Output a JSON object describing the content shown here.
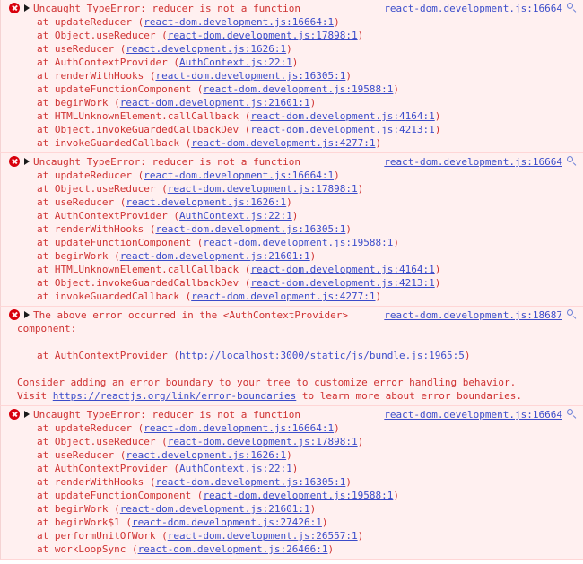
{
  "console": {
    "icons": {
      "error": "error-circle-icon",
      "disclosure": "disclosure-triangle-icon",
      "magnifier": "magnifier-icon"
    },
    "colors": {
      "background": "#fff0f0",
      "text": "#cf3232",
      "link": "#3b4cca",
      "error_icon": "#d8000c",
      "border": "#ffd6d6"
    },
    "groups": [
      {
        "title": "Uncaught TypeError: reducer is not a function",
        "source": "react-dom.development.js:16664",
        "lines": [
          {
            "type": "stack",
            "fn": "at updateReducer (",
            "loc": "react-dom.development.js:16664:1",
            "tail": ")"
          },
          {
            "type": "stack",
            "fn": "at Object.useReducer (",
            "loc": "react-dom.development.js:17898:1",
            "tail": ")"
          },
          {
            "type": "stack",
            "fn": "at useReducer (",
            "loc": "react.development.js:1626:1",
            "tail": ")"
          },
          {
            "type": "stack",
            "fn": "at AuthContextProvider (",
            "loc": "AuthContext.js:22:1",
            "tail": ")"
          },
          {
            "type": "stack",
            "fn": "at renderWithHooks (",
            "loc": "react-dom.development.js:16305:1",
            "tail": ")"
          },
          {
            "type": "stack",
            "fn": "at updateFunctionComponent (",
            "loc": "react-dom.development.js:19588:1",
            "tail": ")"
          },
          {
            "type": "stack",
            "fn": "at beginWork (",
            "loc": "react-dom.development.js:21601:1",
            "tail": ")"
          },
          {
            "type": "stack",
            "fn": "at HTMLUnknownElement.callCallback (",
            "loc": "react-dom.development.js:4164:1",
            "tail": ")"
          },
          {
            "type": "stack",
            "fn": "at Object.invokeGuardedCallbackDev (",
            "loc": "react-dom.development.js:4213:1",
            "tail": ")"
          },
          {
            "type": "stack",
            "fn": "at invokeGuardedCallback (",
            "loc": "react-dom.development.js:4277:1",
            "tail": ")"
          }
        ]
      },
      {
        "title": "Uncaught TypeError: reducer is not a function",
        "source": "react-dom.development.js:16664",
        "lines": [
          {
            "type": "stack",
            "fn": "at updateReducer (",
            "loc": "react-dom.development.js:16664:1",
            "tail": ")"
          },
          {
            "type": "stack",
            "fn": "at Object.useReducer (",
            "loc": "react-dom.development.js:17898:1",
            "tail": ")"
          },
          {
            "type": "stack",
            "fn": "at useReducer (",
            "loc": "react.development.js:1626:1",
            "tail": ")"
          },
          {
            "type": "stack",
            "fn": "at AuthContextProvider (",
            "loc": "AuthContext.js:22:1",
            "tail": ")"
          },
          {
            "type": "stack",
            "fn": "at renderWithHooks (",
            "loc": "react-dom.development.js:16305:1",
            "tail": ")"
          },
          {
            "type": "stack",
            "fn": "at updateFunctionComponent (",
            "loc": "react-dom.development.js:19588:1",
            "tail": ")"
          },
          {
            "type": "stack",
            "fn": "at beginWork (",
            "loc": "react-dom.development.js:21601:1",
            "tail": ")"
          },
          {
            "type": "stack",
            "fn": "at HTMLUnknownElement.callCallback (",
            "loc": "react-dom.development.js:4164:1",
            "tail": ")"
          },
          {
            "type": "stack",
            "fn": "at Object.invokeGuardedCallbackDev (",
            "loc": "react-dom.development.js:4213:1",
            "tail": ")"
          },
          {
            "type": "stack",
            "fn": "at invokeGuardedCallback (",
            "loc": "react-dom.development.js:4277:1",
            "tail": ")"
          }
        ]
      },
      {
        "title": "The above error occurred in the <AuthContextProvider>",
        "source": "react-dom.development.js:18687",
        "lines": [
          {
            "type": "cont",
            "text": "component:"
          },
          {
            "type": "blank"
          },
          {
            "type": "stack",
            "fn": "at AuthContextProvider (",
            "loc": "http://localhost:3000/static/js/bundle.js:1965:5",
            "tail": ")"
          },
          {
            "type": "blank"
          },
          {
            "type": "note",
            "before": "Consider adding an error boundary to your tree to customize error handling behavior.",
            "loc": "",
            "after": ""
          },
          {
            "type": "note",
            "before": "Visit ",
            "loc": "https://reactjs.org/link/error-boundaries",
            "after": " to learn more about error boundaries."
          }
        ]
      },
      {
        "title": "Uncaught TypeError: reducer is not a function",
        "source": "react-dom.development.js:16664",
        "lines": [
          {
            "type": "stack",
            "fn": "at updateReducer (",
            "loc": "react-dom.development.js:16664:1",
            "tail": ")"
          },
          {
            "type": "stack",
            "fn": "at Object.useReducer (",
            "loc": "react-dom.development.js:17898:1",
            "tail": ")"
          },
          {
            "type": "stack",
            "fn": "at useReducer (",
            "loc": "react.development.js:1626:1",
            "tail": ")"
          },
          {
            "type": "stack",
            "fn": "at AuthContextProvider (",
            "loc": "AuthContext.js:22:1",
            "tail": ")"
          },
          {
            "type": "stack",
            "fn": "at renderWithHooks (",
            "loc": "react-dom.development.js:16305:1",
            "tail": ")"
          },
          {
            "type": "stack",
            "fn": "at updateFunctionComponent (",
            "loc": "react-dom.development.js:19588:1",
            "tail": ")"
          },
          {
            "type": "stack",
            "fn": "at beginWork (",
            "loc": "react-dom.development.js:21601:1",
            "tail": ")"
          },
          {
            "type": "stack",
            "fn": "at beginWork$1 (",
            "loc": "react-dom.development.js:27426:1",
            "tail": ")"
          },
          {
            "type": "stack",
            "fn": "at performUnitOfWork (",
            "loc": "react-dom.development.js:26557:1",
            "tail": ")"
          },
          {
            "type": "stack",
            "fn": "at workLoopSync (",
            "loc": "react-dom.development.js:26466:1",
            "tail": ")"
          }
        ]
      }
    ]
  }
}
